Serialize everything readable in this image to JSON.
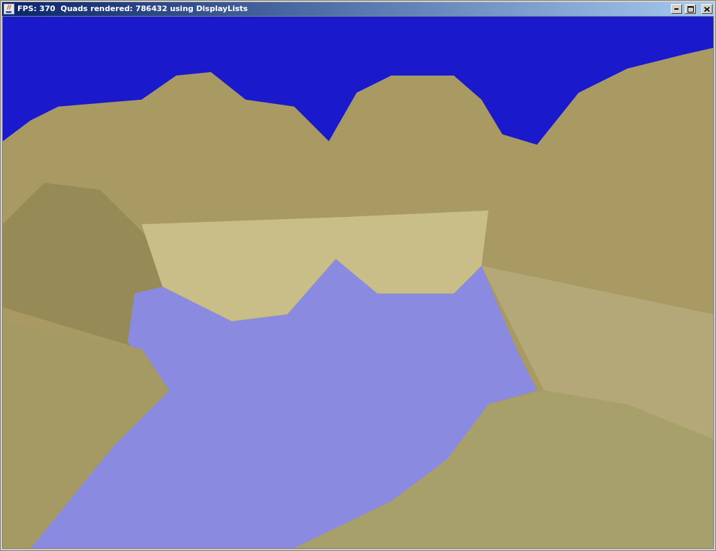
{
  "window": {
    "title": "FPS: 370  Quads rendered: 786432 using DisplayLists"
  }
}
